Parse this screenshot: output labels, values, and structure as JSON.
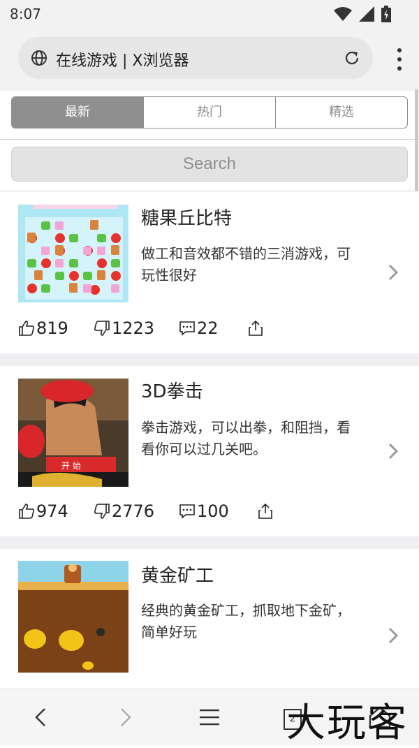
{
  "status_bar": {
    "time": "8:07"
  },
  "browser": {
    "address_text": "在线游戏 | X浏览器",
    "tab_count": "2"
  },
  "tabs": [
    {
      "label": "最新",
      "active": true
    },
    {
      "label": "热门",
      "active": false
    },
    {
      "label": "精选",
      "active": false
    }
  ],
  "search": {
    "placeholder": "Search"
  },
  "games": [
    {
      "title": "糖果丘比特",
      "description": "做工和音效都不错的三消游戏，可玩性很好",
      "likes": "819",
      "dislikes": "1223",
      "comments": "22"
    },
    {
      "title": "3D拳击",
      "description": "拳击游戏，可以出拳，和阻挡，看看你可以过几关吧。",
      "likes": "974",
      "dislikes": "2776",
      "comments": "100"
    },
    {
      "title": "黄金矿工",
      "description": "经典的黄金矿工，抓取地下金矿，简单好玩"
    }
  ],
  "thumbnails": {
    "boxing_button": "开 始"
  },
  "watermark": "大玩客",
  "icons": [
    "wifi-icon",
    "signal-icon",
    "battery-icon",
    "globe-icon",
    "reload-icon",
    "more-vert-icon",
    "thumbs-up-icon",
    "thumbs-down-icon",
    "comment-icon",
    "share-icon",
    "chevron-right-icon",
    "back-icon",
    "forward-icon",
    "menu-icon",
    "tabs-icon",
    "home-icon"
  ]
}
